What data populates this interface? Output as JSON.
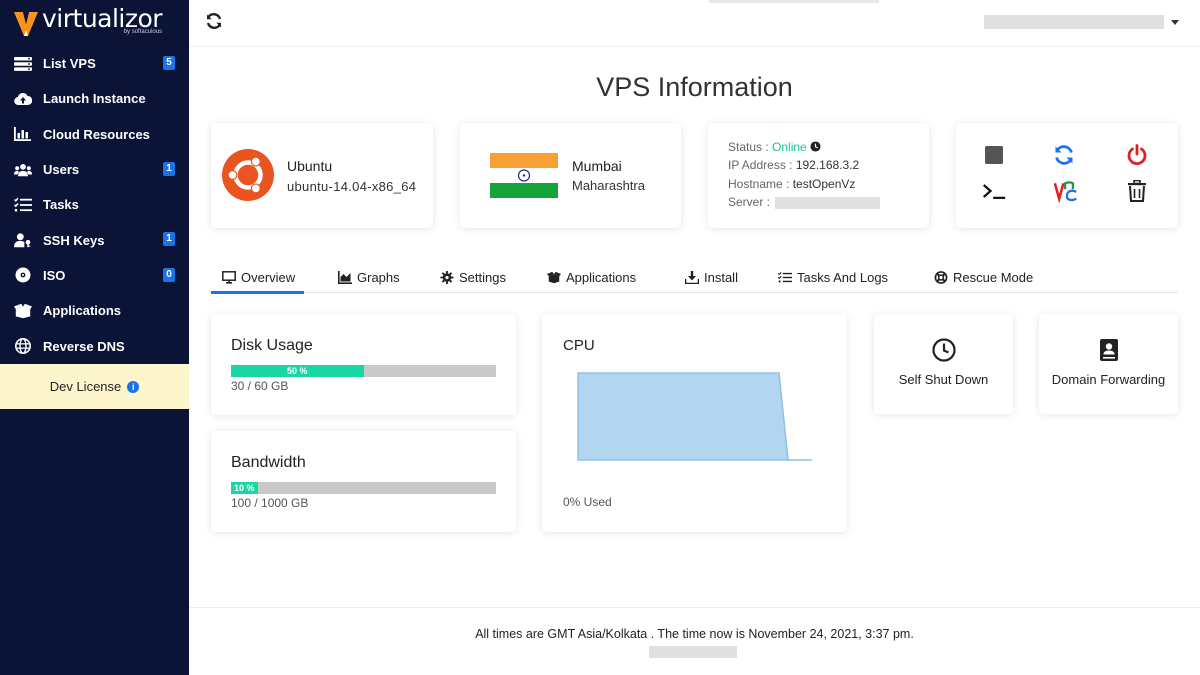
{
  "brand": {
    "name": "virtualizor",
    "sub": "by softaculous"
  },
  "sidebar": {
    "items": [
      {
        "label": "List VPS",
        "icon": "list-icon",
        "badge": "5"
      },
      {
        "label": "Launch Instance",
        "icon": "cloud-upload-icon",
        "badge": ""
      },
      {
        "label": "Cloud Resources",
        "icon": "bar-chart-icon",
        "badge": ""
      },
      {
        "label": "Users",
        "icon": "users-icon",
        "badge": "1"
      },
      {
        "label": "Tasks",
        "icon": "tasks-icon",
        "badge": ""
      },
      {
        "label": "SSH Keys",
        "icon": "user-key-icon",
        "badge": "1"
      },
      {
        "label": "ISO",
        "icon": "disc-icon",
        "badge": "0"
      },
      {
        "label": "Applications",
        "icon": "box-icon",
        "badge": ""
      },
      {
        "label": "Reverse DNS",
        "icon": "globe-icon",
        "badge": ""
      }
    ],
    "dev_license": "Dev License"
  },
  "page": {
    "title": "VPS Information"
  },
  "os": {
    "name": "Ubuntu",
    "version": "ubuntu-14.04-x86_64"
  },
  "location": {
    "city": "Mumbai",
    "state": "Maharashtra"
  },
  "status": {
    "status_label": "Status :",
    "status_value": "Online",
    "ip_label": "IP Address :",
    "ip_value": "192.168.3.2",
    "host_label": "Hostname :",
    "host_value": "testOpenVz",
    "server_label": "Server :"
  },
  "tabs": [
    {
      "label": "Overview",
      "icon": "monitor-icon"
    },
    {
      "label": "Graphs",
      "icon": "area-chart-icon"
    },
    {
      "label": "Settings",
      "icon": "gear-icon"
    },
    {
      "label": "Applications",
      "icon": "box-icon"
    },
    {
      "label": "Install",
      "icon": "download-icon"
    },
    {
      "label": "Tasks And Logs",
      "icon": "tasks-icon"
    },
    {
      "label": "Rescue Mode",
      "icon": "lifebuoy-icon"
    }
  ],
  "disk": {
    "title": "Disk Usage",
    "percent_label": "50 %",
    "percent": 50,
    "detail": "30 / 60 GB"
  },
  "bandwidth": {
    "title": "Bandwidth",
    "percent_label": "10 %",
    "percent": 10,
    "detail": "100 / 1000 GB"
  },
  "cpu": {
    "title": "CPU",
    "used": "0% Used"
  },
  "tiles": {
    "self_shut_down": "Self Shut Down",
    "domain_forwarding": "Domain Forwarding"
  },
  "footer": {
    "text": "All times are GMT Asia/Kolkata . The time now is November 24, 2021, 3:37 pm."
  },
  "colors": {
    "sidebar_bg": "#0b1437",
    "accent": "#1a73e8",
    "online": "#18c39a",
    "progress": "#18d7a4",
    "power": "#e02020"
  }
}
